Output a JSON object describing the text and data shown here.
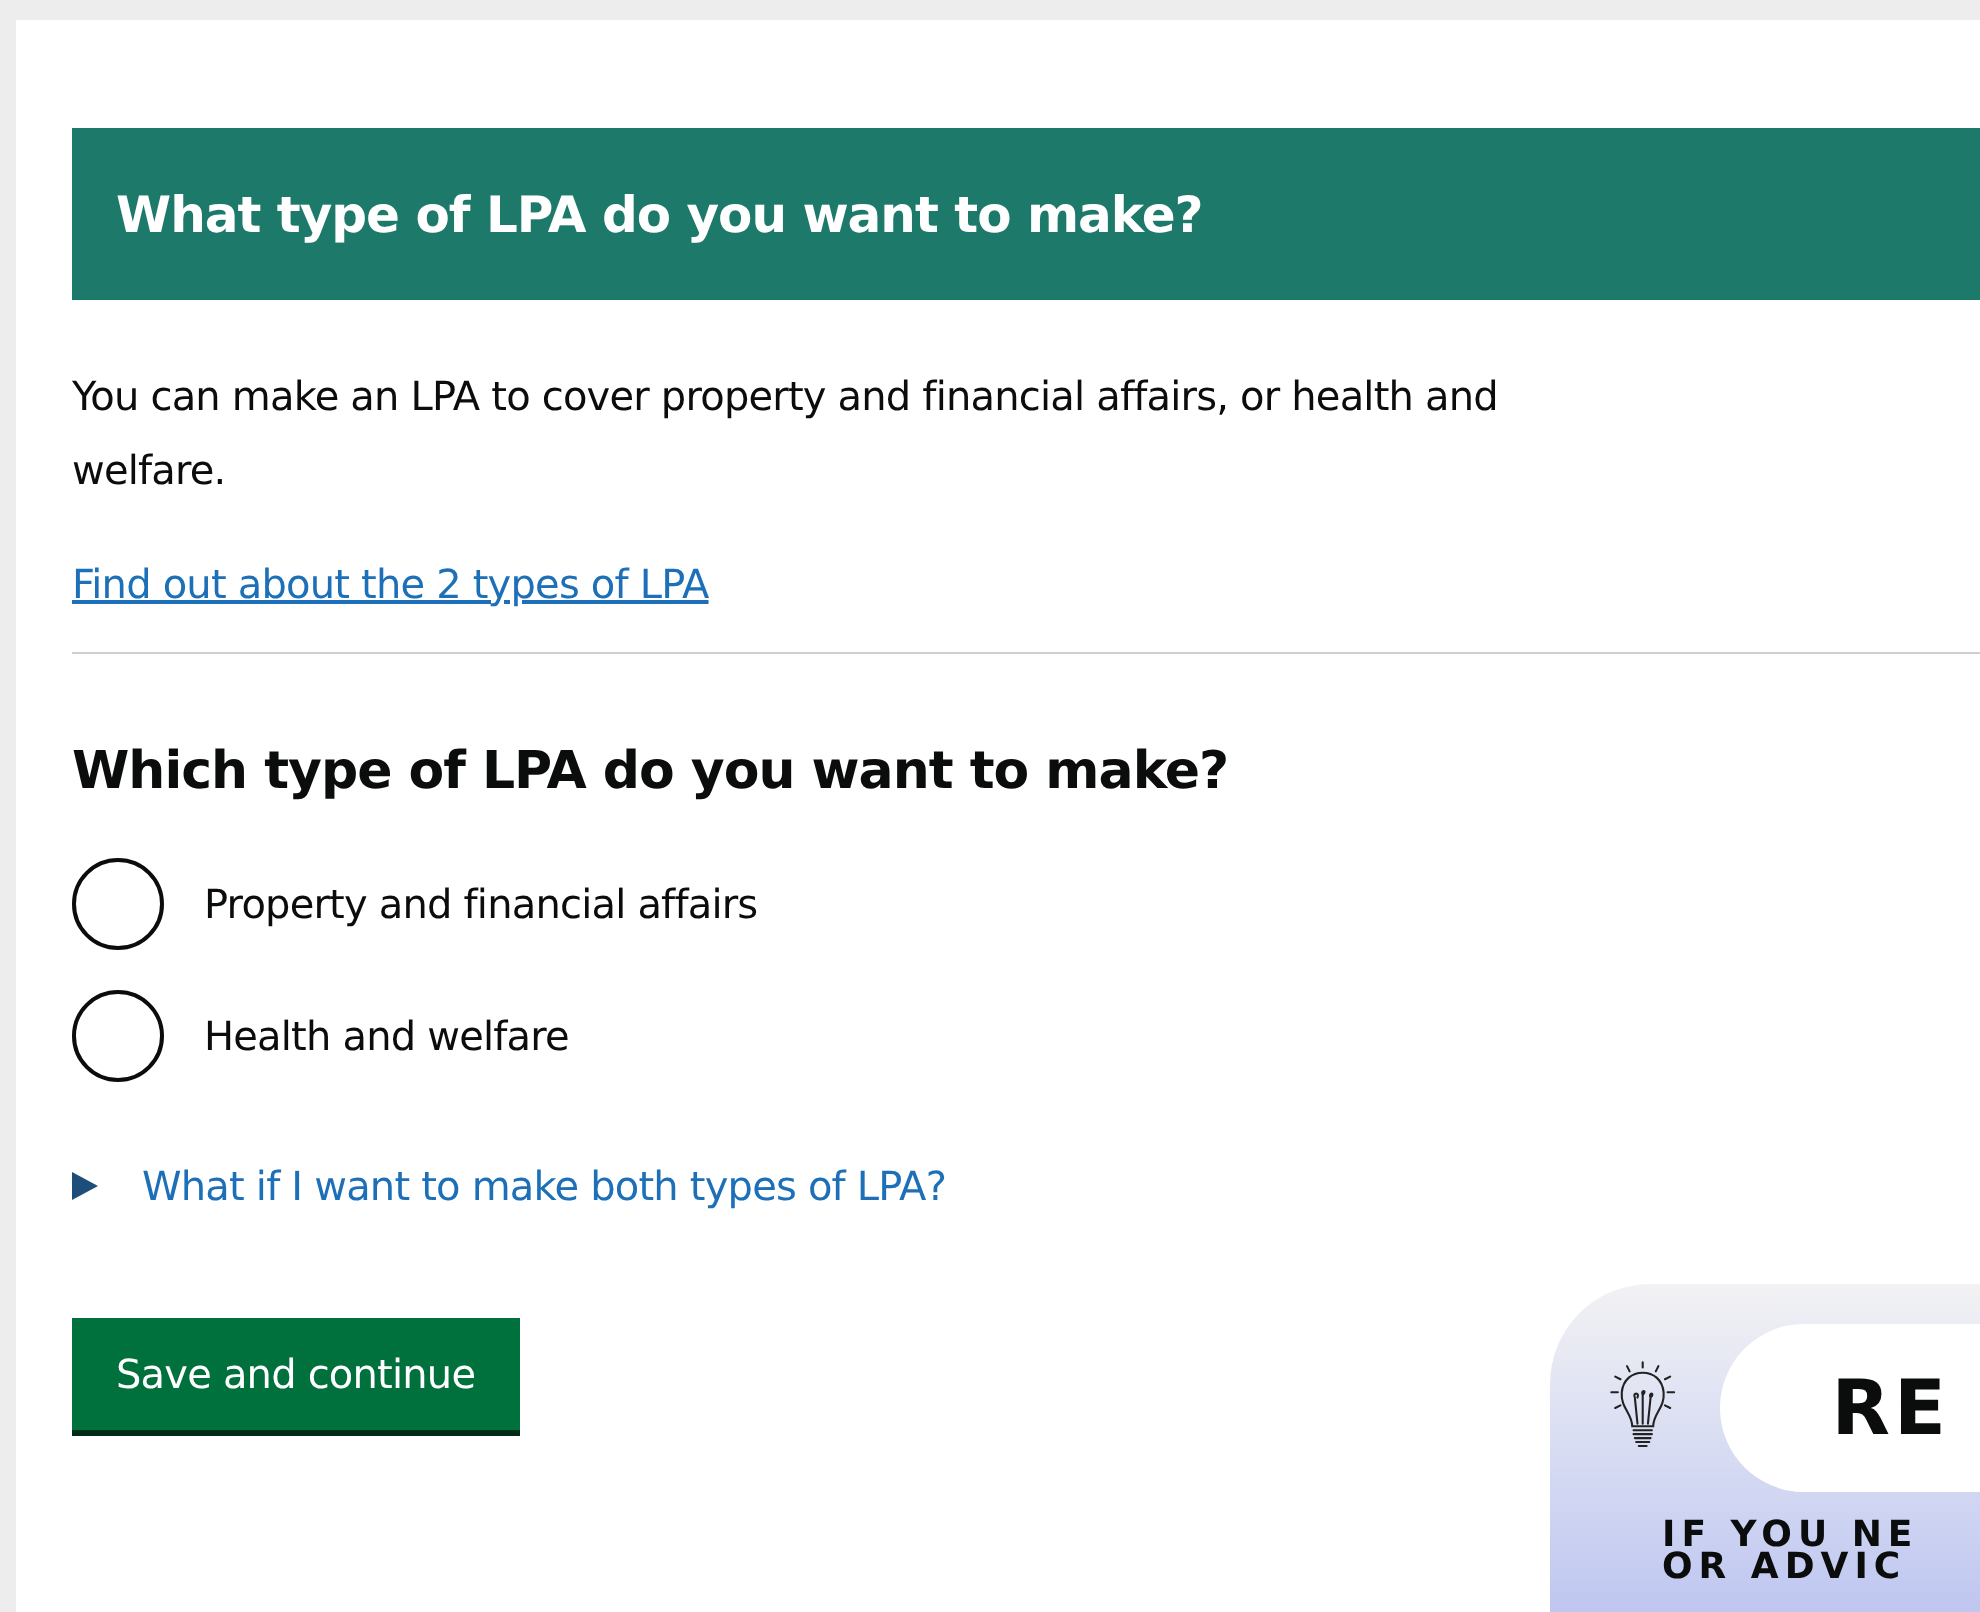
{
  "banner": {
    "title": "What type of LPA do you want to make?"
  },
  "intro": "You can make an LPA to cover property and financial affairs, or health and welfare.",
  "info_link": "Find out about the 2 types of LPA",
  "question": "Which type of LPA do you want to make?",
  "options": [
    {
      "label": "Property and financial affairs",
      "selected": false
    },
    {
      "label": "Health and welfare",
      "selected": false
    }
  ],
  "details": {
    "summary": "What if I want to make both types of LPA?",
    "expanded": false
  },
  "submit": "Save and continue",
  "promo": {
    "badge": "RE",
    "lines": [
      "IF YOU NE",
      "OR ADVIC"
    ]
  }
}
